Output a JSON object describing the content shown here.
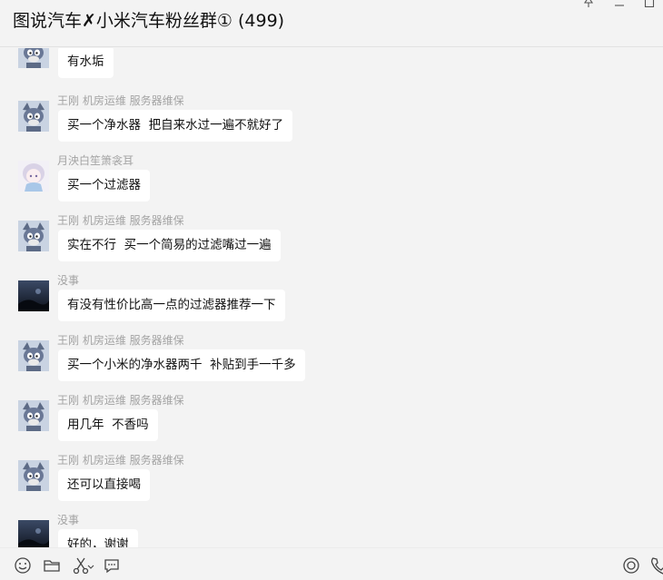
{
  "header": {
    "title": "图说汽车✗小米汽车粉丝群① (499)"
  },
  "window_controls": [
    "pin-icon",
    "minimize-icon",
    "maximize-icon"
  ],
  "messages": [
    {
      "sender": "",
      "text": "有水垢",
      "avatar": "tom-cat-avatar"
    },
    {
      "sender": "王刚 机房运维 服务器维保",
      "text": "买一个净水器  把自来水过一遍不就好了",
      "avatar": "tom-cat-avatar"
    },
    {
      "sender": "月泱白笙箫衾耳",
      "text": "买一个过滤器",
      "avatar": "anime-girl-avatar"
    },
    {
      "sender": "王刚 机房运维 服务器维保",
      "text": "实在不行  买一个简易的过滤嘴过一遍",
      "avatar": "tom-cat-avatar"
    },
    {
      "sender": "没事",
      "text": "有没有性价比高一点的过滤器推荐一下",
      "avatar": "night-sky-avatar"
    },
    {
      "sender": "王刚 机房运维 服务器维保",
      "text": "买一个小米的净水器两千  补贴到手一千多",
      "avatar": "tom-cat-avatar"
    },
    {
      "sender": "王刚 机房运维 服务器维保",
      "text": "用几年  不香吗",
      "avatar": "tom-cat-avatar"
    },
    {
      "sender": "王刚 机房运维 服务器维保",
      "text": "还可以直接喝",
      "avatar": "tom-cat-avatar"
    },
    {
      "sender": "没事",
      "text": "好的，谢谢",
      "avatar": "night-sky-avatar"
    }
  ],
  "toolbar": {
    "left": [
      "emoji-icon",
      "folder-icon",
      "scissors-icon",
      "chat-bubble-icon"
    ],
    "right": [
      "live-icon",
      "phone-icon"
    ]
  },
  "colors": {
    "background": "#f3f3f3",
    "bubble": "#ffffff",
    "sender_text": "#a3a3a3"
  }
}
